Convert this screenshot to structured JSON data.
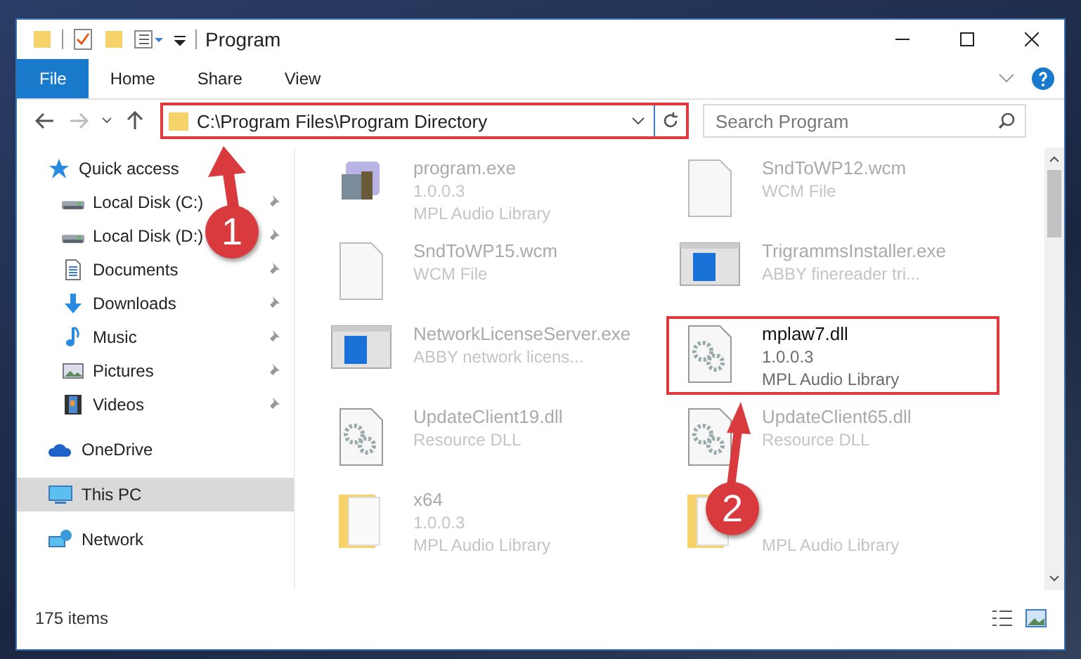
{
  "window": {
    "title": "Program"
  },
  "ribbon": {
    "tabs": [
      {
        "label": "File",
        "kind": "file"
      },
      {
        "label": "Home",
        "kind": "tab"
      },
      {
        "label": "Share",
        "kind": "tab"
      },
      {
        "label": "View",
        "kind": "tab"
      }
    ]
  },
  "address": {
    "path": "C:\\Program Files\\Program Directory",
    "highlighted": true
  },
  "search": {
    "placeholder": "Search Program"
  },
  "nav": {
    "items": [
      {
        "label": "Quick access",
        "kind": "star",
        "pinned": false,
        "selected": false,
        "children": [
          {
            "label": "Local Disk (C:)",
            "kind": "drive",
            "pinned": true,
            "selected": false
          },
          {
            "label": "Local Disk (D:)",
            "kind": "drive",
            "pinned": true,
            "selected": false
          },
          {
            "label": "Documents",
            "kind": "document",
            "pinned": true,
            "selected": false
          },
          {
            "label": "Downloads",
            "kind": "download",
            "pinned": true,
            "selected": false
          },
          {
            "label": "Music",
            "kind": "music",
            "pinned": true,
            "selected": false
          },
          {
            "label": "Pictures",
            "kind": "image",
            "pinned": true,
            "selected": false
          },
          {
            "label": "Videos",
            "kind": "film",
            "pinned": true,
            "selected": false
          }
        ]
      },
      {
        "label": "OneDrive",
        "kind": "cloud",
        "pinned": false,
        "selected": false
      },
      {
        "label": "This PC",
        "kind": "monitor",
        "pinned": false,
        "selected": true
      },
      {
        "label": "Network",
        "kind": "network",
        "pinned": false,
        "selected": false
      }
    ]
  },
  "files": [
    {
      "name": "program.exe",
      "details": [
        "1.0.0.3",
        "MPL Audio Library"
      ],
      "kind": "app",
      "highlighted": false
    },
    {
      "name": "SndToWP12.wcm",
      "details": [
        "WCM File"
      ],
      "kind": "blank",
      "highlighted": false
    },
    {
      "name": "SndToWP15.wcm",
      "details": [
        "WCM File"
      ],
      "kind": "blank",
      "highlighted": false
    },
    {
      "name": "TrigrammsInstaller.exe",
      "details": [
        "ABBY finereader tri..."
      ],
      "kind": "window",
      "highlighted": false
    },
    {
      "name": "NetworkLicenseServer.exe",
      "details": [
        "ABBY network licens..."
      ],
      "kind": "window",
      "highlighted": false
    },
    {
      "name": "mplaw7.dll",
      "details": [
        "1.0.0.3",
        "MPL Audio Library"
      ],
      "kind": "gears",
      "highlighted": true
    },
    {
      "name": "UpdateClient19.dll",
      "details": [
        "Resource DLL"
      ],
      "kind": "gears",
      "highlighted": false
    },
    {
      "name": "UpdateClient65.dll",
      "details": [
        "Resource DLL"
      ],
      "kind": "gears",
      "highlighted": false
    },
    {
      "name": "x64",
      "details": [
        "1.0.0.3",
        "MPL Audio Library"
      ],
      "kind": "folder",
      "highlighted": false
    },
    {
      "details": [
        "MPL Audio Library"
      ],
      "kind": "folder",
      "highlighted": false
    }
  ],
  "status_bar": {
    "count": "175 items"
  },
  "annotations": [
    {
      "number": "1"
    },
    {
      "number": "2"
    }
  ]
}
